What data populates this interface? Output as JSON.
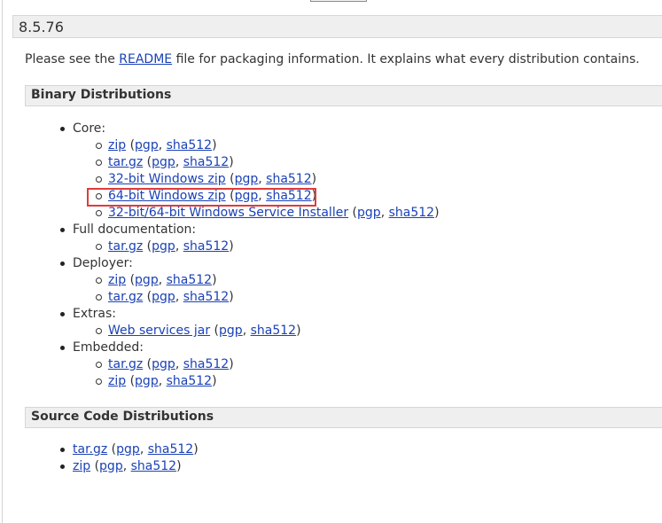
{
  "version": "8.5.76",
  "intro": {
    "before": "Please see the ",
    "link": "README",
    "after": " file for packaging information. It explains what every distribution contains."
  },
  "binary": {
    "title": "Binary Distributions",
    "core_label": "Core:",
    "core": [
      {
        "label": "zip",
        "pgp": "pgp",
        "sha": "sha512"
      },
      {
        "label": "tar.gz",
        "pgp": "pgp",
        "sha": "sha512"
      },
      {
        "label": "32-bit Windows zip",
        "pgp": "pgp",
        "sha": "sha512"
      },
      {
        "label": "64-bit Windows zip",
        "pgp": "pgp",
        "sha": "sha512",
        "highlighted": true
      },
      {
        "label": "32-bit/64-bit Windows Service Installer",
        "pgp": "pgp",
        "sha": "sha512"
      }
    ],
    "fulldoc_label": "Full documentation:",
    "fulldoc": [
      {
        "label": "tar.gz",
        "pgp": "pgp",
        "sha": "sha512"
      }
    ],
    "deployer_label": "Deployer:",
    "deployer": [
      {
        "label": "zip",
        "pgp": "pgp",
        "sha": "sha512"
      },
      {
        "label": "tar.gz",
        "pgp": "pgp",
        "sha": "sha512"
      }
    ],
    "extras_label": "Extras:",
    "extras": [
      {
        "label": "Web services jar",
        "pgp": "pgp",
        "sha": "sha512"
      }
    ],
    "embedded_label": "Embedded:",
    "embedded": [
      {
        "label": "tar.gz",
        "pgp": "pgp",
        "sha": "sha512"
      },
      {
        "label": "zip",
        "pgp": "pgp",
        "sha": "sha512"
      }
    ]
  },
  "source": {
    "title": "Source Code Distributions",
    "items": [
      {
        "label": "tar.gz",
        "pgp": "pgp",
        "sha": "sha512"
      },
      {
        "label": "zip",
        "pgp": "pgp",
        "sha": "sha512"
      }
    ]
  },
  "punct": {
    "open": " (",
    "comma": ", ",
    "close": ")"
  },
  "colors": {
    "link": "#1b42b5",
    "highlight": "#e03b3b",
    "header_bg": "#efefef"
  }
}
